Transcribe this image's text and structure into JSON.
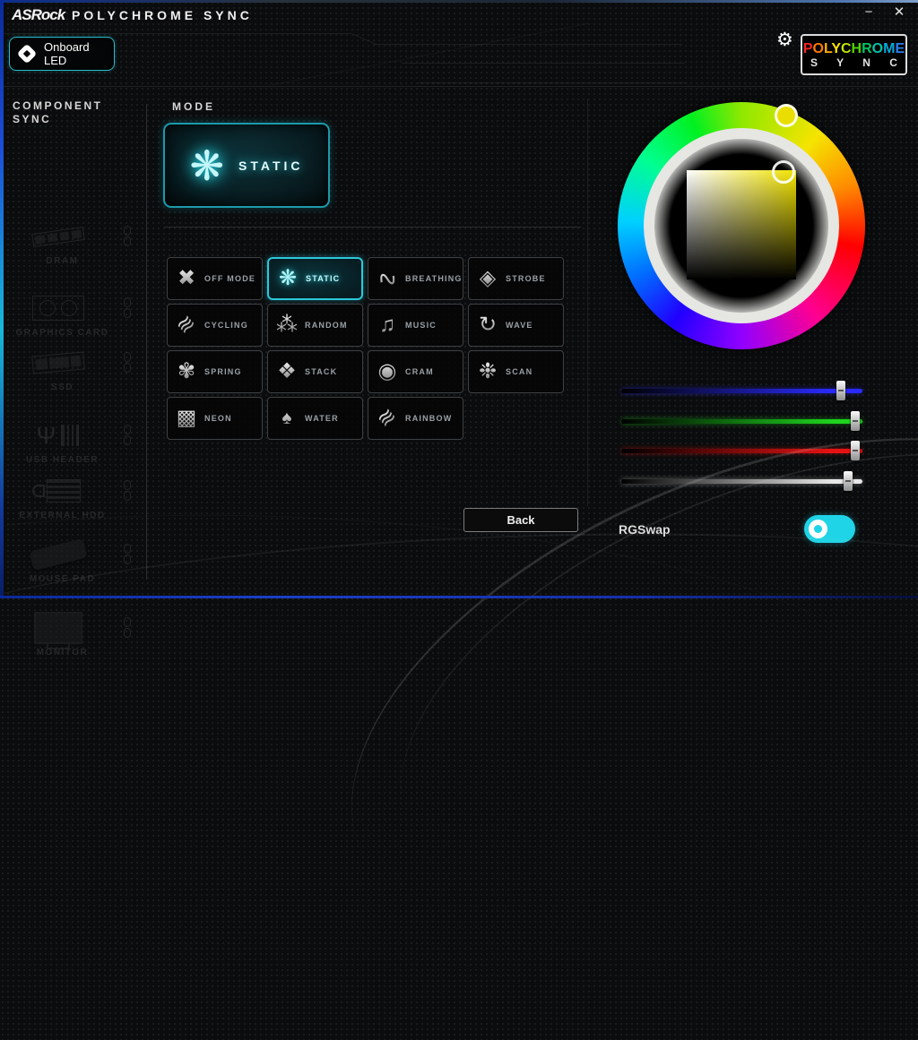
{
  "window": {
    "brand": "ASRock",
    "title": "POLYCHROME SYNC",
    "minimize_glyph": "−",
    "close_glyph": "✕"
  },
  "header": {
    "onboard": {
      "line1": "Onboard",
      "line2": "LED"
    },
    "settings_glyph": "⚙",
    "logo": {
      "letters": [
        {
          "ch": "P",
          "color": "#f42525"
        },
        {
          "ch": "O",
          "color": "#ff7a00"
        },
        {
          "ch": "L",
          "color": "#ffb000"
        },
        {
          "ch": "Y",
          "color": "#ffe400"
        },
        {
          "ch": "C",
          "color": "#bfe400"
        },
        {
          "ch": "H",
          "color": "#4ed400"
        },
        {
          "ch": "R",
          "color": "#00c462"
        },
        {
          "ch": "O",
          "color": "#00c4ac"
        },
        {
          "ch": "M",
          "color": "#00aadc"
        },
        {
          "ch": "E",
          "color": "#2a7ff0"
        }
      ],
      "sync": "S Y N C"
    }
  },
  "sidebar": {
    "title1": "COMPONENT",
    "title2": "SYNC",
    "items": [
      {
        "label": "DRAM",
        "icon": "dram-icon"
      },
      {
        "label": "GRAPHICS CARD",
        "icon": "graphics-card-icon"
      },
      {
        "label": "SSD",
        "icon": "ssd-icon"
      },
      {
        "label": "USB HEADER",
        "icon": "usb-header-icon"
      },
      {
        "label": "EXTERNAL HDD",
        "icon": "external-hdd-icon"
      },
      {
        "label": "MOUSE PAD",
        "icon": "mouse-pad-icon"
      },
      {
        "label": "MONITOR",
        "icon": "monitor-icon"
      }
    ]
  },
  "mode_panel": {
    "label": "MODE",
    "selected": {
      "label": "STATIC",
      "glyph": "❋"
    },
    "modes": [
      {
        "label": "OFF MODE",
        "glyph": "✖",
        "icon": "off-mode-icon",
        "selected": false
      },
      {
        "label": "STATIC",
        "glyph": "❋",
        "icon": "static-icon",
        "selected": true
      },
      {
        "label": "BREATHING",
        "glyph": "∿",
        "icon": "breathing-icon",
        "selected": false
      },
      {
        "label": "STROBE",
        "glyph": "◈",
        "icon": "strobe-icon",
        "selected": false
      },
      {
        "label": "CYCLING",
        "glyph": "≋",
        "icon": "cycling-icon",
        "selected": false
      },
      {
        "label": "RANDOM",
        "glyph": "⁂",
        "icon": "random-icon",
        "selected": false
      },
      {
        "label": "MUSIC",
        "glyph": "♫",
        "icon": "music-icon",
        "selected": false
      },
      {
        "label": "WAVE",
        "glyph": "↻",
        "icon": "wave-icon",
        "selected": false
      },
      {
        "label": "SPRING",
        "glyph": "✾",
        "icon": "spring-icon",
        "selected": false
      },
      {
        "label": "STACK",
        "glyph": "❖",
        "icon": "stack-icon",
        "selected": false
      },
      {
        "label": "CRAM",
        "glyph": "◉",
        "icon": "cram-icon",
        "selected": false
      },
      {
        "label": "SCAN",
        "glyph": "❉",
        "icon": "scan-icon",
        "selected": false
      },
      {
        "label": "NEON",
        "glyph": "▩",
        "icon": "neon-icon",
        "selected": false
      },
      {
        "label": "WATER",
        "glyph": "♠",
        "icon": "water-icon",
        "selected": false
      },
      {
        "label": "RAINBOW",
        "glyph": "≋",
        "icon": "rainbow-icon",
        "selected": false
      }
    ],
    "back_label": "Back"
  },
  "color_panel": {
    "selected_color": "#eade00",
    "sliders": [
      {
        "name": "blue",
        "color_start": "#000000",
        "color_end": "#2a2aff",
        "glow": "rgba(50,50,255,0.55)",
        "position_pct": 91
      },
      {
        "name": "green",
        "color_start": "#000000",
        "color_end": "#1ed41e",
        "glow": "rgba(30,220,30,0.5)",
        "position_pct": 97
      },
      {
        "name": "red",
        "color_start": "#000000",
        "color_end": "#e81212",
        "glow": "rgba(230,20,20,0.5)",
        "position_pct": 97
      },
      {
        "name": "white",
        "color_start": "#000000",
        "color_end": "#e8e8e8",
        "glow": "rgba(220,220,220,0.45)",
        "position_pct": 94
      }
    ],
    "rgswap_label": "RGSwap",
    "toggle_on": true,
    "toggle_color": "#1fd4e6"
  }
}
